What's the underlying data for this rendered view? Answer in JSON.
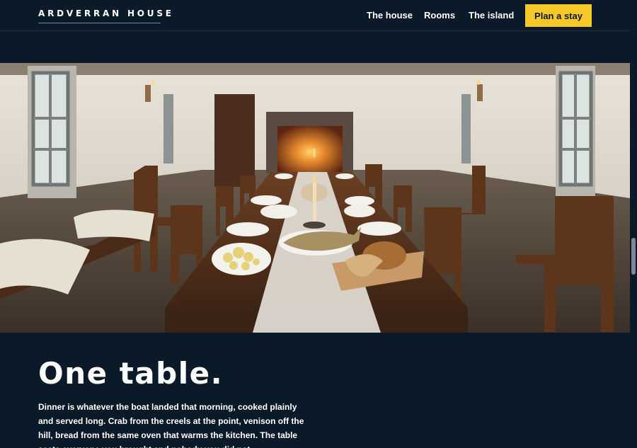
{
  "header": {
    "logo": "ARDVERRAN HOUSE",
    "nav": [
      "The house",
      "Rooms",
      "The island"
    ],
    "cta": "Plan a stay"
  },
  "hero": {
    "icon": "dining-room-image"
  },
  "intro": {
    "title": "One table.",
    "body": "Dinner is whatever the boat landed that morning, cooked plainly and served long. Crab from the creels at the point, venison off the hill, bread from the same oven that warms the kitchen. The table seats everyone you brought and nobody you did not."
  },
  "colors": {
    "background": "#0b1a29",
    "accent": "#f7c82a",
    "text": "#ffffff"
  }
}
